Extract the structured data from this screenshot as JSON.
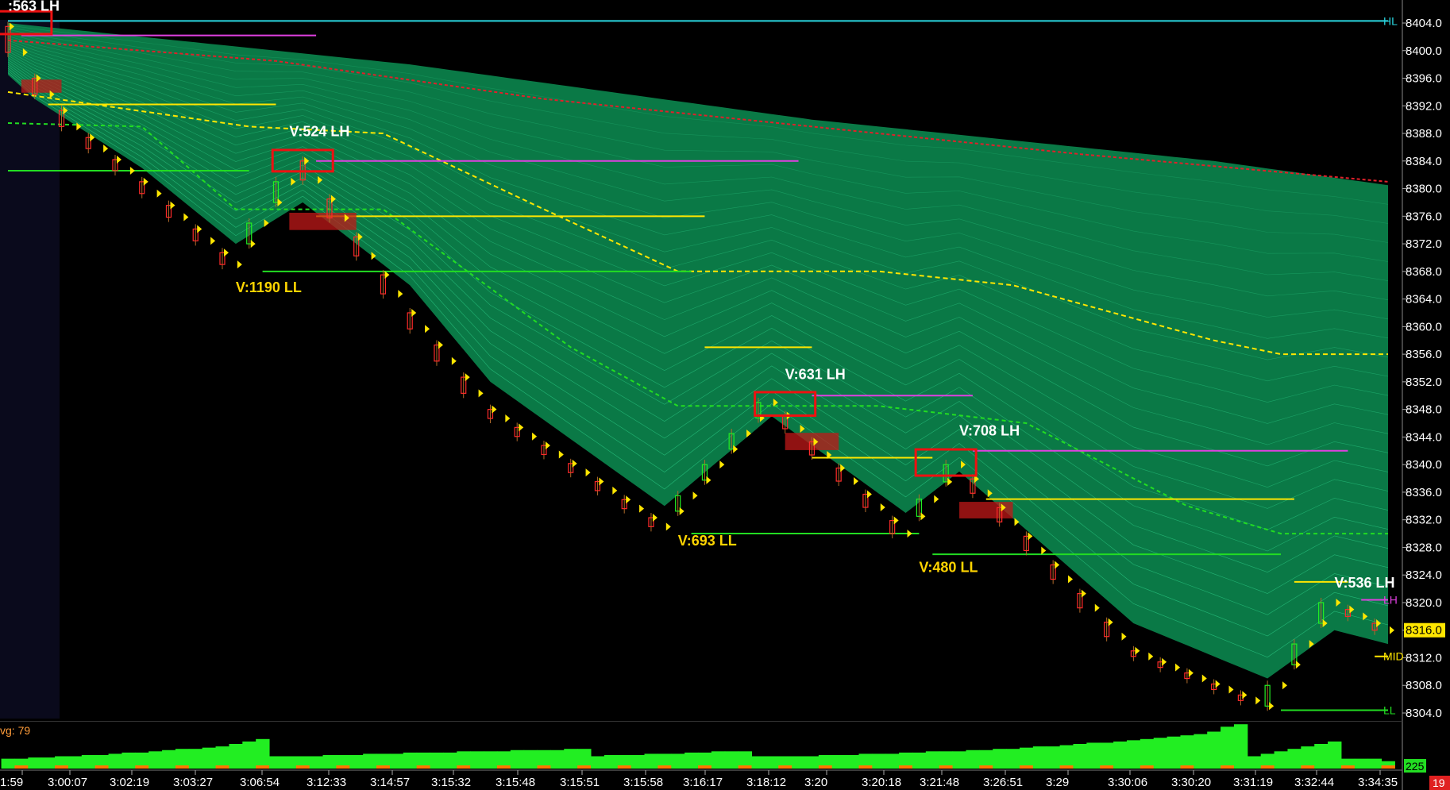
{
  "colors": {
    "background": "#000000",
    "ribbon": "#0b8a50",
    "ribbon_line": "#2fd08a",
    "vwap": "#e0202a",
    "yellow": "#ffe600",
    "magenta": "#e040e0",
    "green": "#22dd22",
    "cyan": "#2ad6e0",
    "box": "#ee1111",
    "volume": "#22ee22",
    "volume_alt": "#ff7700",
    "price_tag_bg": "#ffe600",
    "tag_red": "#e02020"
  },
  "chart_data": {
    "type": "line",
    "title": "",
    "xlabel": "",
    "ylabel": "",
    "ylim": [
      8302,
      8406
    ],
    "y_ticks": [
      "8404.0",
      "8400.0",
      "8396.0",
      "8392.0",
      "8388.0",
      "8384.0",
      "8380.0",
      "8376.0",
      "8372.0",
      "8368.0",
      "8364.0",
      "8360.0",
      "8356.0",
      "8352.0",
      "8348.0",
      "8344.0",
      "8340.0",
      "8336.0",
      "8332.0",
      "8328.0",
      "8324.0",
      "8320.0",
      "8316.0",
      "8312.0",
      "8308.0",
      "8304.0"
    ],
    "x_ticks": [
      "1:59",
      "3:00:07",
      "3:02:19",
      "3:03:27",
      "3:06:54",
      "3:12:33",
      "3:14:57",
      "3:15:32",
      "3:15:48",
      "3:15:51",
      "3:15:58",
      "3:16:17",
      "3:18:12",
      "3:20",
      "3:20:18",
      "3:21:48",
      "3:26:51",
      "3:29",
      "3:30:06",
      "3:30:20",
      "3:31:19",
      "3:32:44",
      "3:34:35"
    ],
    "bar_count": 104,
    "price_path": [
      {
        "bar": 0,
        "price": 8403.5
      },
      {
        "bar": 2,
        "price": 8396
      },
      {
        "bar": 5,
        "price": 8389
      },
      {
        "bar": 10,
        "price": 8381
      },
      {
        "bar": 17,
        "price": 8369
      },
      {
        "bar": 22,
        "price": 8384
      },
      {
        "bar": 30,
        "price": 8362
      },
      {
        "bar": 36,
        "price": 8348
      },
      {
        "bar": 49,
        "price": 8331
      },
      {
        "bar": 57,
        "price": 8349
      },
      {
        "bar": 67,
        "price": 8330
      },
      {
        "bar": 71,
        "price": 8340
      },
      {
        "bar": 84,
        "price": 8313
      },
      {
        "bar": 94,
        "price": 8305
      },
      {
        "bar": 99,
        "price": 8320
      },
      {
        "bar": 103,
        "price": 8316
      }
    ],
    "ribbon_top": [
      {
        "bar": 0,
        "price": 8404.0
      },
      {
        "bar": 30,
        "price": 8398.0
      },
      {
        "bar": 60,
        "price": 8390.0
      },
      {
        "bar": 90,
        "price": 8384.0
      },
      {
        "bar": 103,
        "price": 8380.5
      }
    ],
    "ribbon_bottom": [
      {
        "bar": 0,
        "price": 8396.5
      },
      {
        "bar": 2,
        "price": 8393
      },
      {
        "bar": 10,
        "price": 8383
      },
      {
        "bar": 17,
        "price": 8372
      },
      {
        "bar": 22,
        "price": 8378
      },
      {
        "bar": 30,
        "price": 8366
      },
      {
        "bar": 36,
        "price": 8352
      },
      {
        "bar": 49,
        "price": 8334
      },
      {
        "bar": 57,
        "price": 8347
      },
      {
        "bar": 67,
        "price": 8333
      },
      {
        "bar": 71,
        "price": 8339
      },
      {
        "bar": 84,
        "price": 8317
      },
      {
        "bar": 94,
        "price": 8309
      },
      {
        "bar": 99,
        "price": 8316
      },
      {
        "bar": 103,
        "price": 8314
      }
    ],
    "vwap_line": [
      {
        "bar": 0,
        "price": 8401.5
      },
      {
        "bar": 20,
        "price": 8398.5
      },
      {
        "bar": 40,
        "price": 8393
      },
      {
        "bar": 60,
        "price": 8389
      },
      {
        "bar": 80,
        "price": 8385
      },
      {
        "bar": 103,
        "price": 8381
      }
    ],
    "yellow_dashed": [
      {
        "bar": 0,
        "price": 8394
      },
      {
        "bar": 18,
        "price": 8389
      },
      {
        "bar": 28,
        "price": 8388
      },
      {
        "bar": 40,
        "price": 8377
      },
      {
        "bar": 50,
        "price": 8368
      },
      {
        "bar": 65,
        "price": 8368
      },
      {
        "bar": 75,
        "price": 8366
      },
      {
        "bar": 90,
        "price": 8358
      },
      {
        "bar": 95,
        "price": 8356
      },
      {
        "bar": 103,
        "price": 8356
      }
    ],
    "green_dashed": [
      {
        "bar": 0,
        "price": 8389.5
      },
      {
        "bar": 10,
        "price": 8389
      },
      {
        "bar": 17,
        "price": 8377
      },
      {
        "bar": 28,
        "price": 8377
      },
      {
        "bar": 42,
        "price": 8357
      },
      {
        "bar": 50,
        "price": 8348.5
      },
      {
        "bar": 65,
        "price": 8348.5
      },
      {
        "bar": 76,
        "price": 8346
      },
      {
        "bar": 88,
        "price": 8334
      },
      {
        "bar": 95,
        "price": 8330
      },
      {
        "bar": 103,
        "price": 8330
      }
    ],
    "horizontal_lines": [
      {
        "kind": "HL",
        "color": "cyan",
        "price": 8404.3,
        "from_bar": 0,
        "to_bar": 103
      },
      {
        "kind": "magenta",
        "color": "magenta",
        "price": 8402.2,
        "from_bar": 1,
        "to_bar": 23
      },
      {
        "kind": "yellow",
        "color": "yellow",
        "price": 8392.2,
        "from_bar": 3,
        "to_bar": 20
      },
      {
        "kind": "green",
        "color": "green",
        "price": 8382.6,
        "from_bar": 0,
        "to_bar": 18
      },
      {
        "kind": "magenta",
        "color": "magenta",
        "price": 8384.0,
        "from_bar": 23,
        "to_bar": 59
      },
      {
        "kind": "yellow",
        "color": "yellow",
        "price": 8376.0,
        "from_bar": 23,
        "to_bar": 52
      },
      {
        "kind": "green",
        "color": "green",
        "price": 8368.0,
        "from_bar": 19,
        "to_bar": 51
      },
      {
        "kind": "yellow",
        "color": "yellow",
        "price": 8357.0,
        "from_bar": 52,
        "to_bar": 60
      },
      {
        "kind": "magenta",
        "color": "magenta",
        "price": 8350.0,
        "from_bar": 60,
        "to_bar": 72
      },
      {
        "kind": "green",
        "color": "green",
        "price": 8330.0,
        "from_bar": 51,
        "to_bar": 68
      },
      {
        "kind": "yellow",
        "color": "yellow",
        "price": 8341.0,
        "from_bar": 60,
        "to_bar": 69
      },
      {
        "kind": "magenta",
        "color": "magenta",
        "price": 8342.0,
        "from_bar": 72,
        "to_bar": 100
      },
      {
        "kind": "yellow",
        "color": "yellow",
        "price": 8335.0,
        "from_bar": 73,
        "to_bar": 96
      },
      {
        "kind": "green",
        "color": "green",
        "price": 8327.0,
        "from_bar": 69,
        "to_bar": 95
      },
      {
        "kind": "yellow",
        "color": "yellow",
        "price": 8323.0,
        "from_bar": 96,
        "to_bar": 100
      },
      {
        "kind": "LH",
        "color": "magenta",
        "price": 8320.4,
        "from_bar": 101,
        "to_bar": 103
      },
      {
        "kind": "MID",
        "color": "yellow",
        "price": 8312.2,
        "from_bar": 102,
        "to_bar": 103
      },
      {
        "kind": "LL",
        "color": "green",
        "price": 8304.4,
        "from_bar": 95,
        "to_bar": 103
      }
    ],
    "boxes": [
      {
        "bar": 1,
        "price_high": 8405.7,
        "price_low": 8402.4
      },
      {
        "bar": 22,
        "price_high": 8385.6,
        "price_low": 8382.5
      },
      {
        "bar": 58,
        "price_high": 8350.5,
        "price_low": 8347.1
      },
      {
        "bar": 70,
        "price_high": 8342.2,
        "price_low": 8338.4
      }
    ],
    "supply_zones": [
      {
        "bar_from": 1,
        "bar_to": 4,
        "price_high": 8395.8,
        "price_low": 8393.9
      },
      {
        "bar_from": 21,
        "bar_to": 26,
        "price_high": 8376.5,
        "price_low": 8374.0
      },
      {
        "bar_from": 58,
        "bar_to": 62,
        "price_high": 8344.6,
        "price_low": 8342.1
      },
      {
        "bar_from": 71,
        "bar_to": 75,
        "price_high": 8334.6,
        "price_low": 8332.2
      }
    ],
    "annotations": [
      {
        "text": ":563 LH",
        "style": "white",
        "bar": 0,
        "price": 8405.8
      },
      {
        "text": "V:524 LH",
        "style": "white",
        "bar": 21,
        "price": 8387.6
      },
      {
        "text": "V:1190 LL",
        "style": "yellow",
        "bar": 17,
        "price": 8365.0
      },
      {
        "text": "V:631 LH",
        "style": "white",
        "bar": 58,
        "price": 8352.4
      },
      {
        "text": "V:693 LL",
        "style": "yellow",
        "bar": 50,
        "price": 8328.3
      },
      {
        "text": "V:708 LH",
        "style": "white",
        "bar": 71,
        "price": 8344.2
      },
      {
        "text": "V:480 LL",
        "style": "yellow",
        "bar": 68,
        "price": 8324.4
      },
      {
        "text": "V:536 LH",
        "style": "white",
        "bar": 99,
        "price": 8322.2
      }
    ],
    "line_tags": {
      "hl": "HL",
      "lh": "LH",
      "mid": "MID",
      "ll": "LL"
    },
    "last_price": "8316.0",
    "current_price": 8316.0,
    "volume_label": "vg: 79",
    "volume_last": "225",
    "corner_value": "19",
    "volume": [
      8,
      8,
      9,
      9,
      10,
      10,
      11,
      11,
      12,
      13,
      13,
      14,
      15,
      16,
      16,
      17,
      18,
      20,
      22,
      24,
      10,
      10,
      10,
      10,
      11,
      11,
      11,
      12,
      12,
      12,
      13,
      13,
      13,
      13,
      14,
      14,
      14,
      14,
      15,
      15,
      15,
      15,
      16,
      16,
      10,
      11,
      11,
      11,
      12,
      12,
      12,
      13,
      13,
      14,
      14,
      14,
      10,
      10,
      10,
      10,
      10,
      11,
      11,
      11,
      12,
      12,
      12,
      13,
      13,
      14,
      14,
      14,
      15,
      15,
      16,
      16,
      17,
      18,
      18,
      19,
      20,
      21,
      21,
      22,
      23,
      24,
      25,
      26,
      27,
      28,
      30,
      34,
      36,
      10,
      12,
      14,
      16,
      18,
      20,
      22,
      8,
      8,
      8,
      6
    ]
  }
}
